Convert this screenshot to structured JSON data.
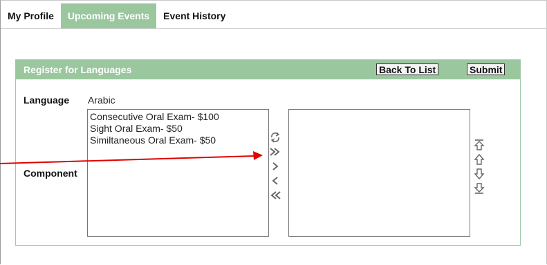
{
  "tabs": [
    {
      "label": "My Profile",
      "active": false
    },
    {
      "label": "Upcoming Events",
      "active": true
    },
    {
      "label": "Event History",
      "active": false
    }
  ],
  "panel": {
    "title": "Register for Languages",
    "back_label": "Back To List",
    "submit_label": "Submit"
  },
  "form": {
    "language_label": "Language",
    "language_value": "Arabic",
    "component_label": "Component",
    "available_components": [
      "Consecutive Oral Exam- $100",
      "Sight Oral Exam- $50",
      "Similtaneous Oral Exam- $50"
    ],
    "selected_components": []
  },
  "icons": {
    "transfer": [
      "swap-icon",
      "move-all-right-icon",
      "move-right-icon",
      "move-left-icon",
      "move-all-left-icon"
    ],
    "ordering": [
      "move-top-icon",
      "move-up-icon",
      "move-down-icon",
      "move-bottom-icon"
    ]
  },
  "colors": {
    "accent_green": "#9ac79e",
    "annotation_red": "#e00000"
  }
}
